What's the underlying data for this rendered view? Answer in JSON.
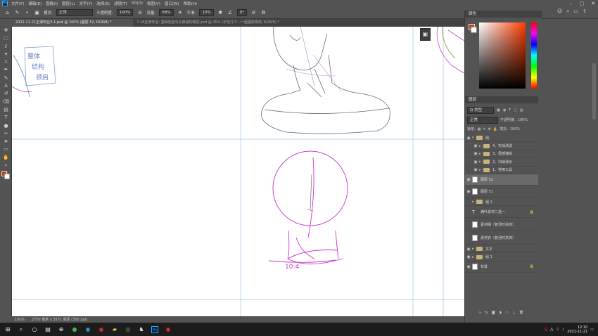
{
  "app": {
    "logo": "Ps",
    "menus": [
      "文件(F)",
      "编辑(E)",
      "图像(I)",
      "图层(L)",
      "文字(Y)",
      "选择(S)",
      "滤镜(T)",
      "3D(D)",
      "视图(V)",
      "窗口(W)",
      "帮助(H)"
    ]
  },
  "options": {
    "mode_label": "模式:",
    "mode_value": "正常",
    "opacity_label": "不透明度:",
    "opacity_value": "100%",
    "flow_label": "流量:",
    "flow_value": "68%",
    "smooth_label": "平滑:",
    "smooth_value": "10%",
    "angle_value": "0°"
  },
  "tabs": [
    {
      "label": "2021-11-21正课作业3-1.psd @ 100% (图层 52, RGB/8) *"
    },
    {
      "label": "7-18正课作业: 基础造型与头像结构概述.psd @ 25% (示范几个…一起图层修改, RGB/8) *"
    }
  ],
  "colors": {
    "foreground": "#c4400e",
    "background": "#ffffff",
    "accent": "#31a8ff"
  },
  "canvas": {
    "handwriting": [
      "整体",
      "结构",
      "颈肩"
    ],
    "sketch_label": "10:4"
  },
  "status": {
    "zoom": "100%",
    "doc_info": "2750 像素 x 3571 像素 (300 ppi)"
  },
  "color_panel": {
    "title": "颜色"
  },
  "layers_panel": {
    "title": "图层",
    "filter_label": "Q 类型",
    "blend_mode": "正常",
    "opacity_label": "不透明度:",
    "opacity_value": "100%",
    "lock_label": "锁定:",
    "fill_label": "填充:",
    "fill_value": "100%",
    "layers": [
      {
        "name": "例",
        "kind": "group",
        "level": 0
      },
      {
        "name": "4、实战测试",
        "kind": "group",
        "level": 1
      },
      {
        "name": "3、局部描绘",
        "kind": "group",
        "level": 1
      },
      {
        "name": "2、归纳演示",
        "kind": "group",
        "level": 1
      },
      {
        "name": "1、常用工具",
        "kind": "group",
        "level": 1
      },
      {
        "name": "图层 52",
        "kind": "pixel",
        "level": 0,
        "selected": true
      },
      {
        "name": "图层 51",
        "kind": "pixel",
        "level": 0
      },
      {
        "name": "组 2",
        "kind": "group",
        "level": 0
      },
      {
        "name": "满叶素材二选一",
        "kind": "text",
        "level": 0,
        "locked": true
      },
      {
        "name": "素材绳（复活时关掉）",
        "kind": "pixel",
        "level": 0
      },
      {
        "name": "素材衣（复活时关掉）",
        "kind": "pixel",
        "level": 0
      },
      {
        "name": "文字",
        "kind": "group",
        "level": 0
      },
      {
        "name": "组 1",
        "kind": "group",
        "level": 0
      },
      {
        "name": "背景",
        "kind": "pixel",
        "level": 0,
        "locked": true
      }
    ]
  },
  "taskbar": {
    "time": "12:10",
    "date": "2021-11-21"
  }
}
